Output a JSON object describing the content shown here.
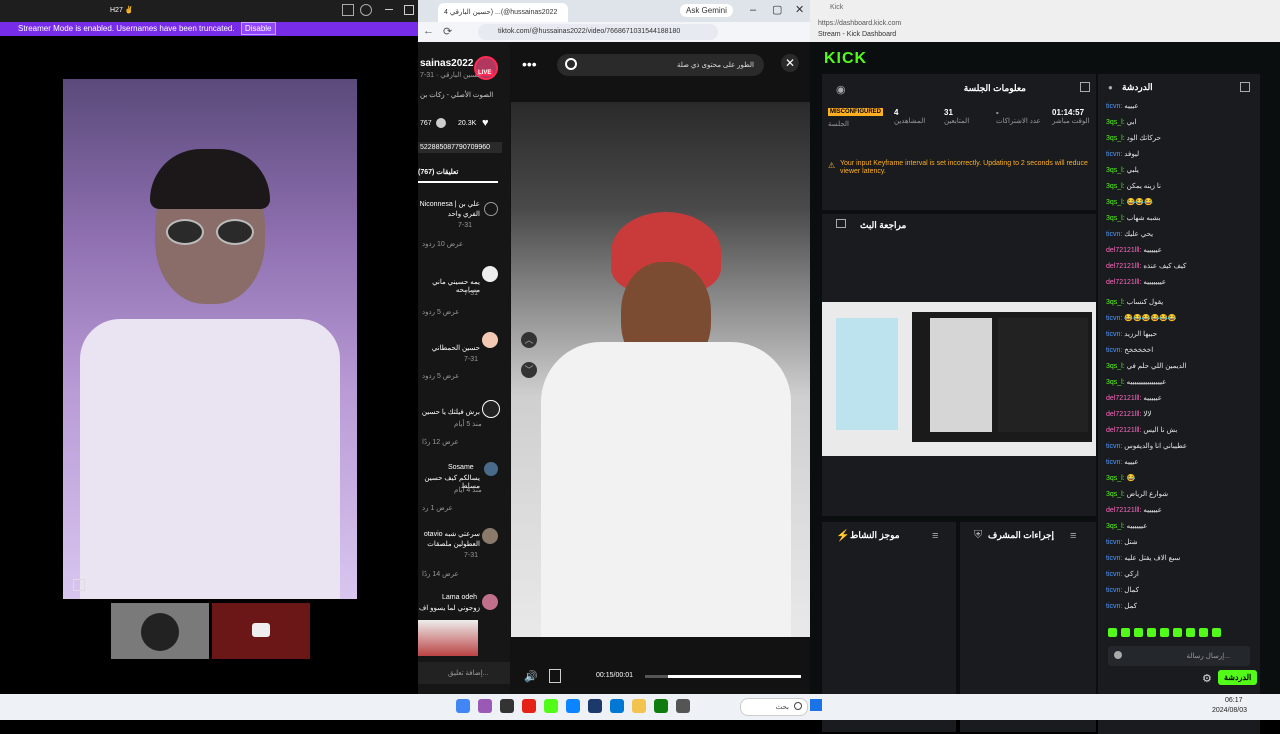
{
  "left": {
    "topbar_text": "H27 ✌",
    "streamer_msg": "Streamer Mode is enabled. Usernames have been truncated.",
    "disable_btn": "Disable"
  },
  "tiktok": {
    "tab_title": "حسين البارقي 4) ...(@hussainas2022",
    "gemini": "Ask Gemini",
    "url": "tiktok.com/@hussainas2022/video/7668671031544188180",
    "search_placeholder": "الطور على محتوى ذي صلة",
    "username": "sainas2022",
    "display_name": "حسين البارقي · 31-7",
    "sound": "الصوت الأصلي - زكات بن",
    "likes": "767",
    "comments": "20.3K",
    "link": "522885087790709960",
    "comments_tab": "تعليقات (767)",
    "comments_list": [
      {
        "name": "Niconnesa | علي بن",
        "text": "الفري واحد",
        "date": "7-31",
        "replies": "عرض 10 ردود"
      },
      {
        "name": "يمه حسيني ماني مسامحه",
        "text": "",
        "date": "7-31",
        "replies": "عرض 5 ردود"
      },
      {
        "name": "حسين الحمطاني",
        "text": "",
        "date": "7-31",
        "replies": "عرض 5 ردود"
      },
      {
        "name": "برش فيلتك يا حسين",
        "text": "",
        "date": "منذ 5 أيام",
        "replies": "عرض 12 ردًا"
      },
      {
        "name": "Sosame",
        "text": "يسالكم كيف حسين مسلط",
        "date": "منذ 4 أيام",
        "replies": "عرض 1 رد"
      },
      {
        "name": "otavio سرعتي شبه",
        "text": "العطولين ملصقات",
        "date": "7-31",
        "replies": "عرض 14 ردًا"
      },
      {
        "name": "Lama odeh",
        "text": "زوجوني لما يسوو اف",
        "date": "",
        "replies": ""
      }
    ],
    "add_comment": "إضافة تعليق...",
    "time": "00:15/00:01"
  },
  "kick": {
    "window_title": "Kick",
    "url": "https://dashboard.kick.com",
    "tab": "Stream - Kick Dashboard",
    "logo": "KICK",
    "session_title": "معلومات الجلسة",
    "stats": [
      {
        "value": "01:14:57",
        "label": "الوقت مباشر"
      },
      {
        "value": "-",
        "label": "عدد الاشتراكات"
      },
      {
        "value": "31",
        "label": "المتابعين"
      },
      {
        "value": "4",
        "label": "المشاهدين"
      },
      {
        "value": "MISCONFIGURED",
        "label": "الجلسة"
      }
    ],
    "warning": "Your input Keyframe interval is set incorrectly. Updating to 2 seconds will reduce viewer latency.",
    "preview_title": "مراجعة البث",
    "activity_title": "موجز النشاط",
    "mod_title": "إجراءات المشرف",
    "chat_title": "الدردشة",
    "chat_input": "إرسال رسالة...",
    "chat_btn": "الدردشة",
    "chat": [
      {
        "u": "ticvn:",
        "c": "pink",
        "m": "عيييه"
      },
      {
        "u": "3qs_l:",
        "c": "green",
        "m": "ابي"
      },
      {
        "u": "3qs_l:",
        "c": "green",
        "m": "حركاتك الود"
      },
      {
        "u": "ticvn:",
        "c": "pink",
        "m": "ليوفد"
      },
      {
        "u": "3qs_l:",
        "c": "green",
        "m": "يلبي"
      },
      {
        "u": "3qs_l:",
        "c": "green",
        "m": "نا زينه يمكن"
      },
      {
        "u": "3qs_l:",
        "c": "green",
        "m": "😂😂😂"
      },
      {
        "u": "3qs_l:",
        "c": "green",
        "m": "بشبه شهاب"
      },
      {
        "u": "ticvn:",
        "c": "pink",
        "m": "يحي عليك"
      },
      {
        "u": "del72121lll:",
        "c": "pink",
        "m": "عيييييه"
      },
      {
        "u": "del72121lll:",
        "c": "pink",
        "m": "كيف كيف عنذه"
      },
      {
        "u": "del72121lll:",
        "c": "pink",
        "m": "عيييييييه"
      },
      {
        "u": "3qs_l:",
        "c": "green",
        "m": "يقول كنساب"
      },
      {
        "u": "ticvn:",
        "c": "pink",
        "m": "😂😂😂😂😂😂"
      },
      {
        "u": "ticvn:",
        "c": "pink",
        "m": "حبيها الرزيد"
      },
      {
        "u": "ticvn:",
        "c": "pink",
        "m": "اخخخخخخ"
      },
      {
        "u": "3qs_l:",
        "c": "green",
        "m": "الديمين اللي حلم في"
      },
      {
        "u": "3qs_l:",
        "c": "green",
        "m": "عيييييييييييييييه"
      },
      {
        "u": "del72121lll:",
        "c": "pink",
        "m": "عيييييه"
      },
      {
        "u": "del72121lll:",
        "c": "pink",
        "m": "لالا"
      },
      {
        "u": "del72121lll:",
        "c": "pink",
        "m": "بش نا اليس"
      },
      {
        "u": "ticvn:",
        "c": "pink",
        "m": "عطيباني انا والديفوس"
      },
      {
        "u": "ticvn:",
        "c": "pink",
        "m": "عيييه"
      },
      {
        "u": "3qs_l:",
        "c": "green",
        "m": "😂"
      },
      {
        "u": "3qs_l:",
        "c": "green",
        "m": "شوارع الرياض"
      },
      {
        "u": "del72121lll:",
        "c": "pink",
        "m": "عيييييه"
      },
      {
        "u": "3qs_l:",
        "c": "green",
        "m": "عييييييه"
      },
      {
        "u": "ticvn:",
        "c": "pink",
        "m": "شتل"
      },
      {
        "u": "ticvn:",
        "c": "pink",
        "m": "سبع الاف يقتل عليه"
      },
      {
        "u": "ticvn:",
        "c": "pink",
        "m": "اركي"
      },
      {
        "u": "ticvn:",
        "c": "pink",
        "m": "كمال"
      },
      {
        "u": "ticvn:",
        "c": "pink",
        "m": "كمل"
      }
    ]
  },
  "taskbar": {
    "time": "06:17",
    "date": "2024/08/03",
    "search": "بحث"
  }
}
